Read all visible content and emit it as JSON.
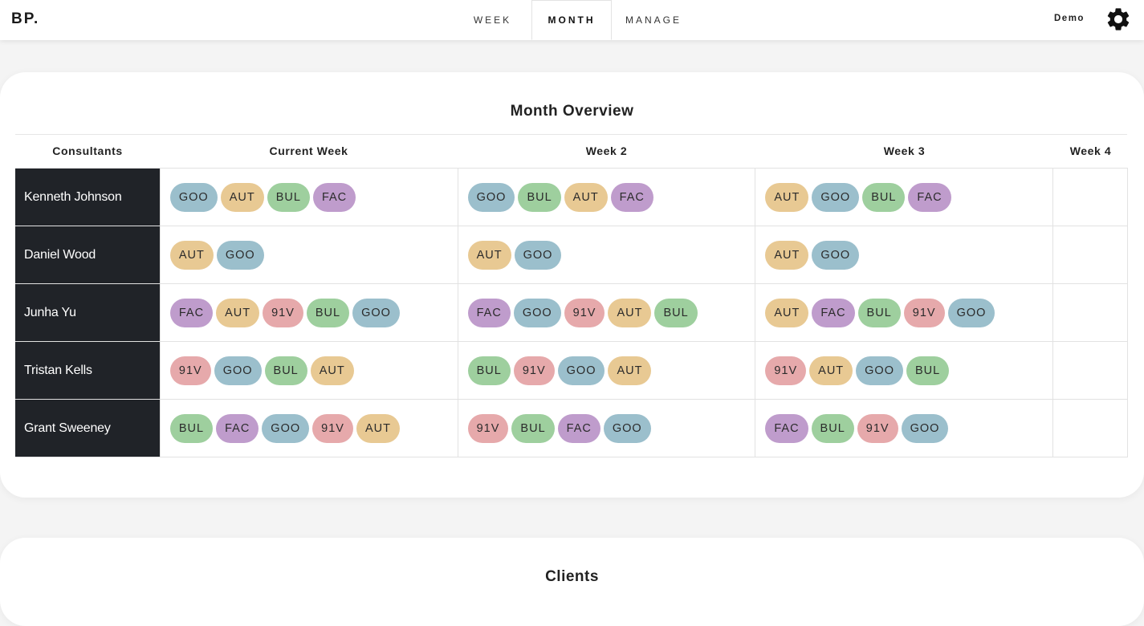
{
  "brand": "BP.",
  "nav": {
    "tabs": [
      {
        "label": "WEEK",
        "active": false
      },
      {
        "label": "MONTH",
        "active": true
      },
      {
        "label": "MANAGE",
        "active": false
      }
    ]
  },
  "user": {
    "label": "Demo",
    "settings_icon": "gear-icon"
  },
  "month_overview": {
    "title": "Month Overview",
    "columns": [
      "Consultants",
      "Current Week",
      "Week 2",
      "Week 3",
      "Week 4"
    ],
    "rows": [
      {
        "name": "Kenneth Johnson",
        "weeks": [
          [
            "GOO",
            "AUT",
            "BUL",
            "FAC"
          ],
          [
            "GOO",
            "BUL",
            "AUT",
            "FAC"
          ],
          [
            "AUT",
            "GOO",
            "BUL",
            "FAC"
          ],
          []
        ]
      },
      {
        "name": "Daniel Wood",
        "weeks": [
          [
            "AUT",
            "GOO"
          ],
          [
            "AUT",
            "GOO"
          ],
          [
            "AUT",
            "GOO"
          ],
          []
        ]
      },
      {
        "name": "Junha Yu",
        "weeks": [
          [
            "FAC",
            "AUT",
            "91V",
            "BUL",
            "GOO"
          ],
          [
            "FAC",
            "GOO",
            "91V",
            "AUT",
            "BUL"
          ],
          [
            "AUT",
            "FAC",
            "BUL",
            "91V",
            "GOO"
          ],
          []
        ]
      },
      {
        "name": "Tristan Kells",
        "weeks": [
          [
            "91V",
            "GOO",
            "BUL",
            "AUT"
          ],
          [
            "BUL",
            "91V",
            "GOO",
            "AUT"
          ],
          [
            "91V",
            "AUT",
            "GOO",
            "BUL"
          ],
          []
        ]
      },
      {
        "name": "Grant Sweeney",
        "weeks": [
          [
            "BUL",
            "FAC",
            "GOO",
            "91V",
            "AUT"
          ],
          [
            "91V",
            "BUL",
            "FAC",
            "GOO"
          ],
          [
            "FAC",
            "BUL",
            "91V",
            "GOO"
          ],
          []
        ]
      }
    ]
  },
  "client_colors": {
    "GOO": "#9bbfcc",
    "AUT": "#e8c993",
    "BUL": "#9ecf9e",
    "FAC": "#bf9ccc",
    "91V": "#e6a9ab"
  },
  "clients": {
    "title": "Clients"
  }
}
